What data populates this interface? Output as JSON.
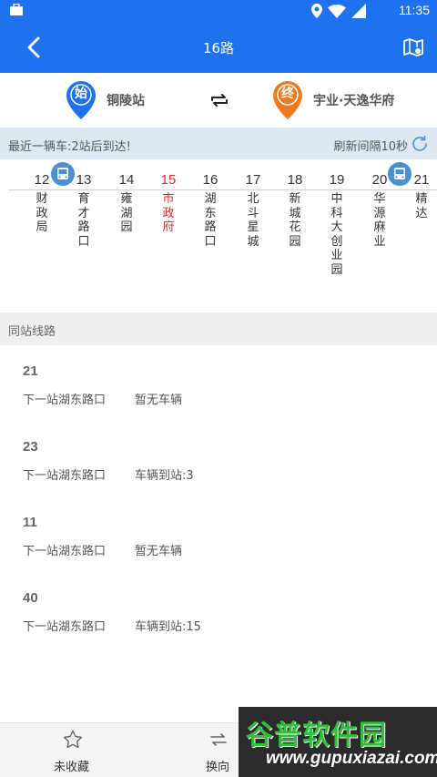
{
  "status_bar": {
    "time": "11:35",
    "icons": [
      "bag-icon",
      "location-icon",
      "wifi-icon",
      "signal-icon"
    ]
  },
  "header": {
    "title": "16路",
    "back_icon": "back-arrow-icon",
    "map_icon": "map-icon",
    "color": "#1e72f0"
  },
  "endpoints": {
    "start_badge": "始",
    "start_name": "铜陵站",
    "end_badge": "终",
    "end_name": "宇业·天逸华府",
    "start_color": "#1e72f0",
    "end_color": "#f07a1e"
  },
  "info": {
    "recent": "最近一辆车:2站后到达!",
    "refresh": "刷新间隔10秒"
  },
  "stations": [
    {
      "num": "12",
      "name": "财政局"
    },
    {
      "num": "13",
      "name": "育才路口"
    },
    {
      "num": "14",
      "name": "雍湖园"
    },
    {
      "num": "15",
      "name": "市政府",
      "current": true
    },
    {
      "num": "16",
      "name": "湖东路口"
    },
    {
      "num": "17",
      "name": "北斗星城"
    },
    {
      "num": "18",
      "name": "新城花园"
    },
    {
      "num": "19",
      "name": "中科大创业园"
    },
    {
      "num": "20",
      "name": "华源麻业"
    },
    {
      "num": "21",
      "name": "精达"
    }
  ],
  "same_station": {
    "title": "同站线路",
    "routes": [
      {
        "num": "21",
        "next": "下一站湖东路口",
        "status": "暂无车辆"
      },
      {
        "num": "23",
        "next": "下一站湖东路口",
        "status": "车辆到站:3"
      },
      {
        "num": "11",
        "next": "下一站湖东路口",
        "status": "暂无车辆"
      },
      {
        "num": "40",
        "next": "下一站湖东路口",
        "status": "车辆到站:15"
      }
    ]
  },
  "bottom_bar": {
    "favorite_label": "未收藏",
    "swap_label": "换向"
  },
  "watermark": {
    "logo": "谷普软件园",
    "url": "www.gupuxiazai.com"
  }
}
